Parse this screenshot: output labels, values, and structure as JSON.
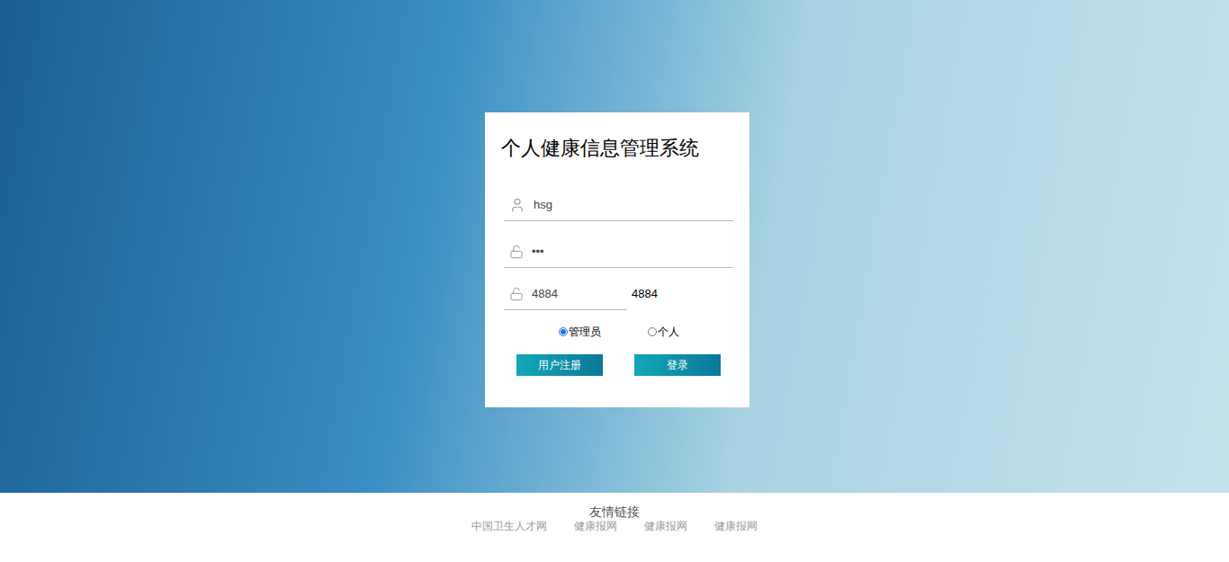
{
  "title": "个人健康信息管理系统",
  "fields": [
    {
      "kind": "user",
      "value": "hsg"
    },
    {
      "kind": "password",
      "value": "•••"
    }
  ],
  "captcha": {
    "value": "4884",
    "code": "4884"
  },
  "roles": [
    {
      "label": "管理员",
      "selected": true
    },
    {
      "label": "个人",
      "selected": false
    }
  ],
  "buttons": [
    "用户注册",
    "登录"
  ],
  "footer": {
    "title": "友情链接",
    "links": [
      "中国卫生人才网",
      "健康报网",
      "健康报网",
      "健康报网"
    ]
  }
}
